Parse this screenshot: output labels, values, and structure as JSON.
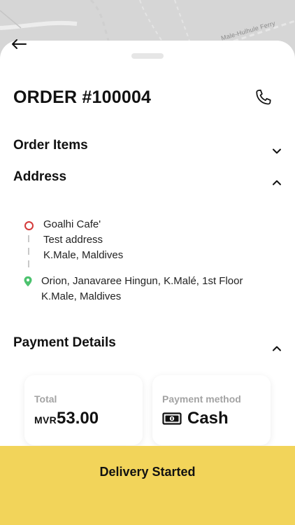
{
  "map": {
    "label": "Male-Hulhule Ferry"
  },
  "order": {
    "title": "ORDER #100004"
  },
  "sections": {
    "order_items": "Order Items",
    "address": "Address",
    "payment": "Payment Details"
  },
  "pickup": {
    "name": "Goalhi Cafe'",
    "line1": "Test address",
    "line2": "K.Male, Maldives"
  },
  "dropoff": {
    "line1": "Orion, Janavaree Hingun, K.Malé, 1st Floor",
    "line2": "K.Male, Maldives"
  },
  "payment": {
    "total_label": "Total",
    "currency": "MVR",
    "amount": "53.00",
    "method_label": "Payment method",
    "method_value": "Cash"
  },
  "status": {
    "label": "Delivery Started"
  },
  "icons": {
    "back": "arrow-left-icon",
    "phone": "phone-icon",
    "expand": "chevron-down-icon",
    "collapse": "chevron-up-icon",
    "origin": "circle-marker-icon",
    "destination": "location-pin-icon",
    "cash": "banknote-icon"
  },
  "colors": {
    "accent": "#f2d45a",
    "origin_marker": "#d43a3a",
    "destination_marker": "#4cc26e"
  }
}
